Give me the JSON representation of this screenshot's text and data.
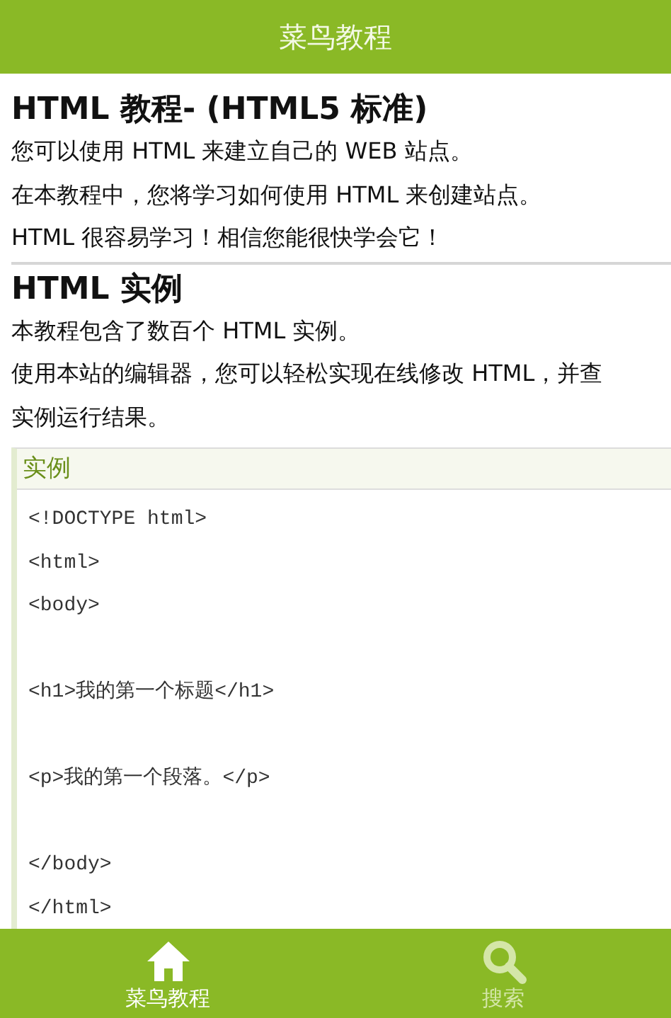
{
  "header": {
    "title": "菜鸟教程"
  },
  "sections": [
    {
      "heading": "HTML 教程- (HTML5 标准)",
      "lines": [
        "您可以使用 HTML 来建立自己的 WEB 站点。",
        "在本教程中，您将学习如何使用 HTML 来创建站点。",
        "HTML 很容易学习！相信您能很快学会它！"
      ]
    },
    {
      "heading": "HTML 实例",
      "lines": [
        "本教程包含了数百个 HTML 实例。",
        "使用本站的编辑器，您可以轻松实现在线修改 HTML，并查",
        "实例运行结果。"
      ]
    }
  ],
  "example": {
    "label": "实例",
    "code": [
      {
        "kind": "line",
        "text": "<!DOCTYPE html>"
      },
      {
        "kind": "line",
        "text": "<html>"
      },
      {
        "kind": "line",
        "text": "<body>"
      },
      {
        "kind": "blank"
      },
      {
        "kind": "line",
        "text": "<h1>我的第一个标题</h1>"
      },
      {
        "kind": "blank"
      },
      {
        "kind": "line",
        "text": "<p>我的第一个段落。</p>"
      },
      {
        "kind": "blank"
      },
      {
        "kind": "line",
        "text": "</body>"
      },
      {
        "kind": "line",
        "text": "</html>"
      }
    ]
  },
  "bottom_nav": [
    {
      "kind": "home",
      "label": "菜鸟教程",
      "selected": true
    },
    {
      "kind": "search",
      "label": "搜索",
      "selected": false
    }
  ]
}
